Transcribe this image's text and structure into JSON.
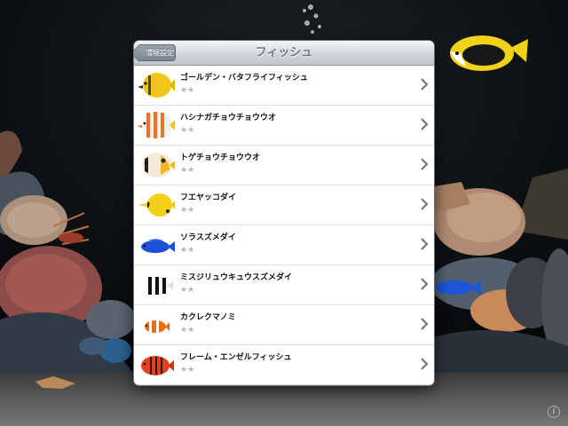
{
  "navbar": {
    "back_label": "環境設定",
    "title": "フィッシュ"
  },
  "fish_list": [
    {
      "name": "ゴールデン・バタフライフィッシュ",
      "rating": "★★",
      "icon": "golden-butterflyfish-icon"
    },
    {
      "name": "ハシナガチョウチョウウオ",
      "rating": "★★",
      "icon": "copperband-butterflyfish-icon"
    },
    {
      "name": "トゲチョウチョウウオ",
      "rating": "★★",
      "icon": "threadfin-butterflyfish-icon"
    },
    {
      "name": "フエヤッコダイ",
      "rating": "★★",
      "icon": "longnose-butterflyfish-icon"
    },
    {
      "name": "ソラスズメダイ",
      "rating": "★★",
      "icon": "blue-damselfish-icon"
    },
    {
      "name": "ミスジリュウキュウスズメダイ",
      "rating": "★★",
      "icon": "humbug-damselfish-icon"
    },
    {
      "name": "カクレクマノミ",
      "rating": "★★",
      "icon": "clownfish-icon"
    },
    {
      "name": "フレーム・エンゼルフィッシュ",
      "rating": "★★",
      "icon": "flame-angelfish-icon"
    }
  ],
  "info_label": "i",
  "colors": {
    "navbar_title": "#6f7783",
    "back_button": "#8a94a1",
    "background": "#0b0d10"
  }
}
